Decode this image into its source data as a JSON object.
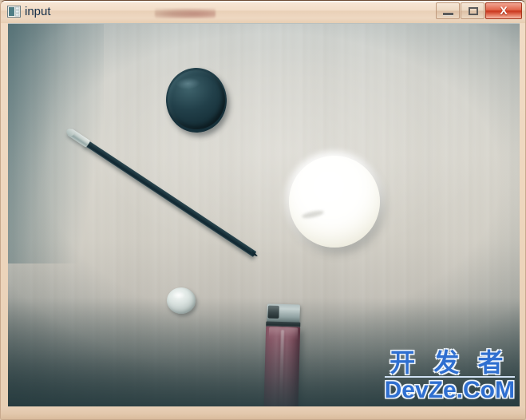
{
  "window": {
    "title": "input",
    "icon": "application-window-icon",
    "titlebar_smudge": "",
    "controls": {
      "minimize_label": "–",
      "maximize_label": "□",
      "close_label": "X",
      "close_color": "#c8341b",
      "minimize_name": "minimize-button",
      "maximize_name": "maximize-button",
      "close_name": "close-button"
    },
    "frame_color": "#eed7bf",
    "titlebar_color": "#f2ddc8"
  },
  "client": {
    "kind": "camera-image",
    "description": "Top-down photo of a light wooden desk surface with several objects",
    "background_color": "#d6d6d0",
    "vignette_color": "#2e464a",
    "objects": [
      {
        "name": "jar-lid",
        "label": "dark round jar lid",
        "color": "#22404a"
      },
      {
        "name": "pencil",
        "label": "dark pencil with silver ferrule",
        "color": "#1b343d"
      },
      {
        "name": "white-ball",
        "label": "white ball",
        "color": "#fdfdf6"
      },
      {
        "name": "coin",
        "label": "small silver coin",
        "color": "#dfe7e4"
      },
      {
        "name": "lighter",
        "label": "pink disposable lighter",
        "color": "#a9596c"
      }
    ]
  },
  "watermark": {
    "chinese": "开 发 者",
    "english": "DevZe.CoM",
    "color": "#2f6fd0"
  }
}
